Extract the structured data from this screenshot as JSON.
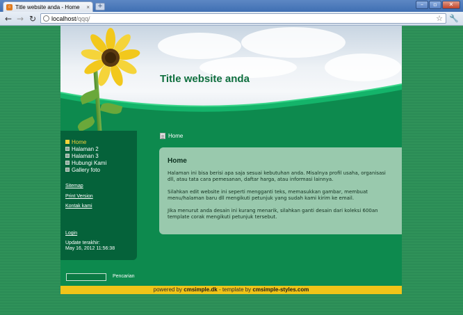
{
  "browser": {
    "tab_title": "Title website anda - Home",
    "tab_close": "×",
    "newtab": "+",
    "url_host": "localhost",
    "url_path": "/qqq/",
    "window_buttons": [
      "–",
      "▫",
      "✕"
    ]
  },
  "site": {
    "title": "Title website anda",
    "menu": [
      {
        "label": "Home",
        "active": true
      },
      {
        "label": "Halaman 2",
        "active": false
      },
      {
        "label": "Halaman 3",
        "active": false
      },
      {
        "label": "Hubungi Kami",
        "active": false
      },
      {
        "label": "Gallery foto",
        "active": false
      }
    ],
    "links": {
      "sitemap": "Sitemap",
      "print": "Print Version",
      "contact": "Kontak kami",
      "login": "Login"
    },
    "updated_label": "Update terakhir:",
    "updated_value": "May 16, 2012 11:56:38",
    "search_label": "Pencarian",
    "breadcrumb": "Home",
    "content": {
      "heading": "Home",
      "p1": "Halaman ini bisa berisi apa saja sesuai kebutuhan anda. Misalnya profil usaha, organisasi dll, atau tata cara pemesanan, daftar harga, atau informasi lainnya.",
      "p2": "Silahkan edit website ini seperti mengganti teks, memasukkan gambar, membuat menu/halaman baru dll mengikuti petunjuk yang sudah kami kirim ke email.",
      "p3": "Jika menurut anda desain ini kurang menarik, silahkan ganti desain dari koleksi 600an template corak mengikuti petunjuk tersebut."
    },
    "footer": {
      "powered_prefix": "powered by ",
      "powered_name": "cmsimple.dk",
      "template_prefix": " - template by ",
      "template_name": "cmsimple-styles.com"
    }
  },
  "colors": {
    "background_green": "#2a8a55",
    "site_green": "#0d8a4e",
    "sidebar_green": "#05623a",
    "content_box": "#99c9ad",
    "title_green": "#0f6f3e",
    "active_menu": "#f3d23a",
    "footer_yellow": "#f0c419"
  }
}
